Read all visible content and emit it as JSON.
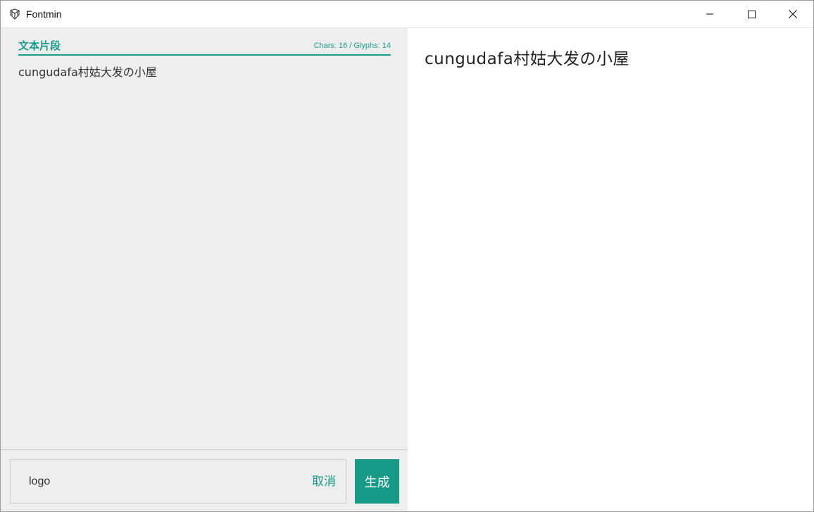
{
  "window": {
    "title": "Fontmin",
    "icon": "fontmin-logo-icon",
    "controls": [
      "minimize-icon",
      "maximize-icon",
      "close-icon"
    ]
  },
  "editor": {
    "section_title": "文本片段",
    "stats": "Chars: 16 / Glyphs: 14",
    "text": "cungudafa村姑大发の小屋"
  },
  "footer": {
    "font_name_value": "logo",
    "cancel_label": "取消",
    "generate_label": "生成"
  },
  "preview": {
    "text": "cungudafa村姑大发の小屋"
  },
  "colors": {
    "accent": "#1a9c8a",
    "button": "#179a87",
    "panel_bg": "#eeeeee"
  }
}
